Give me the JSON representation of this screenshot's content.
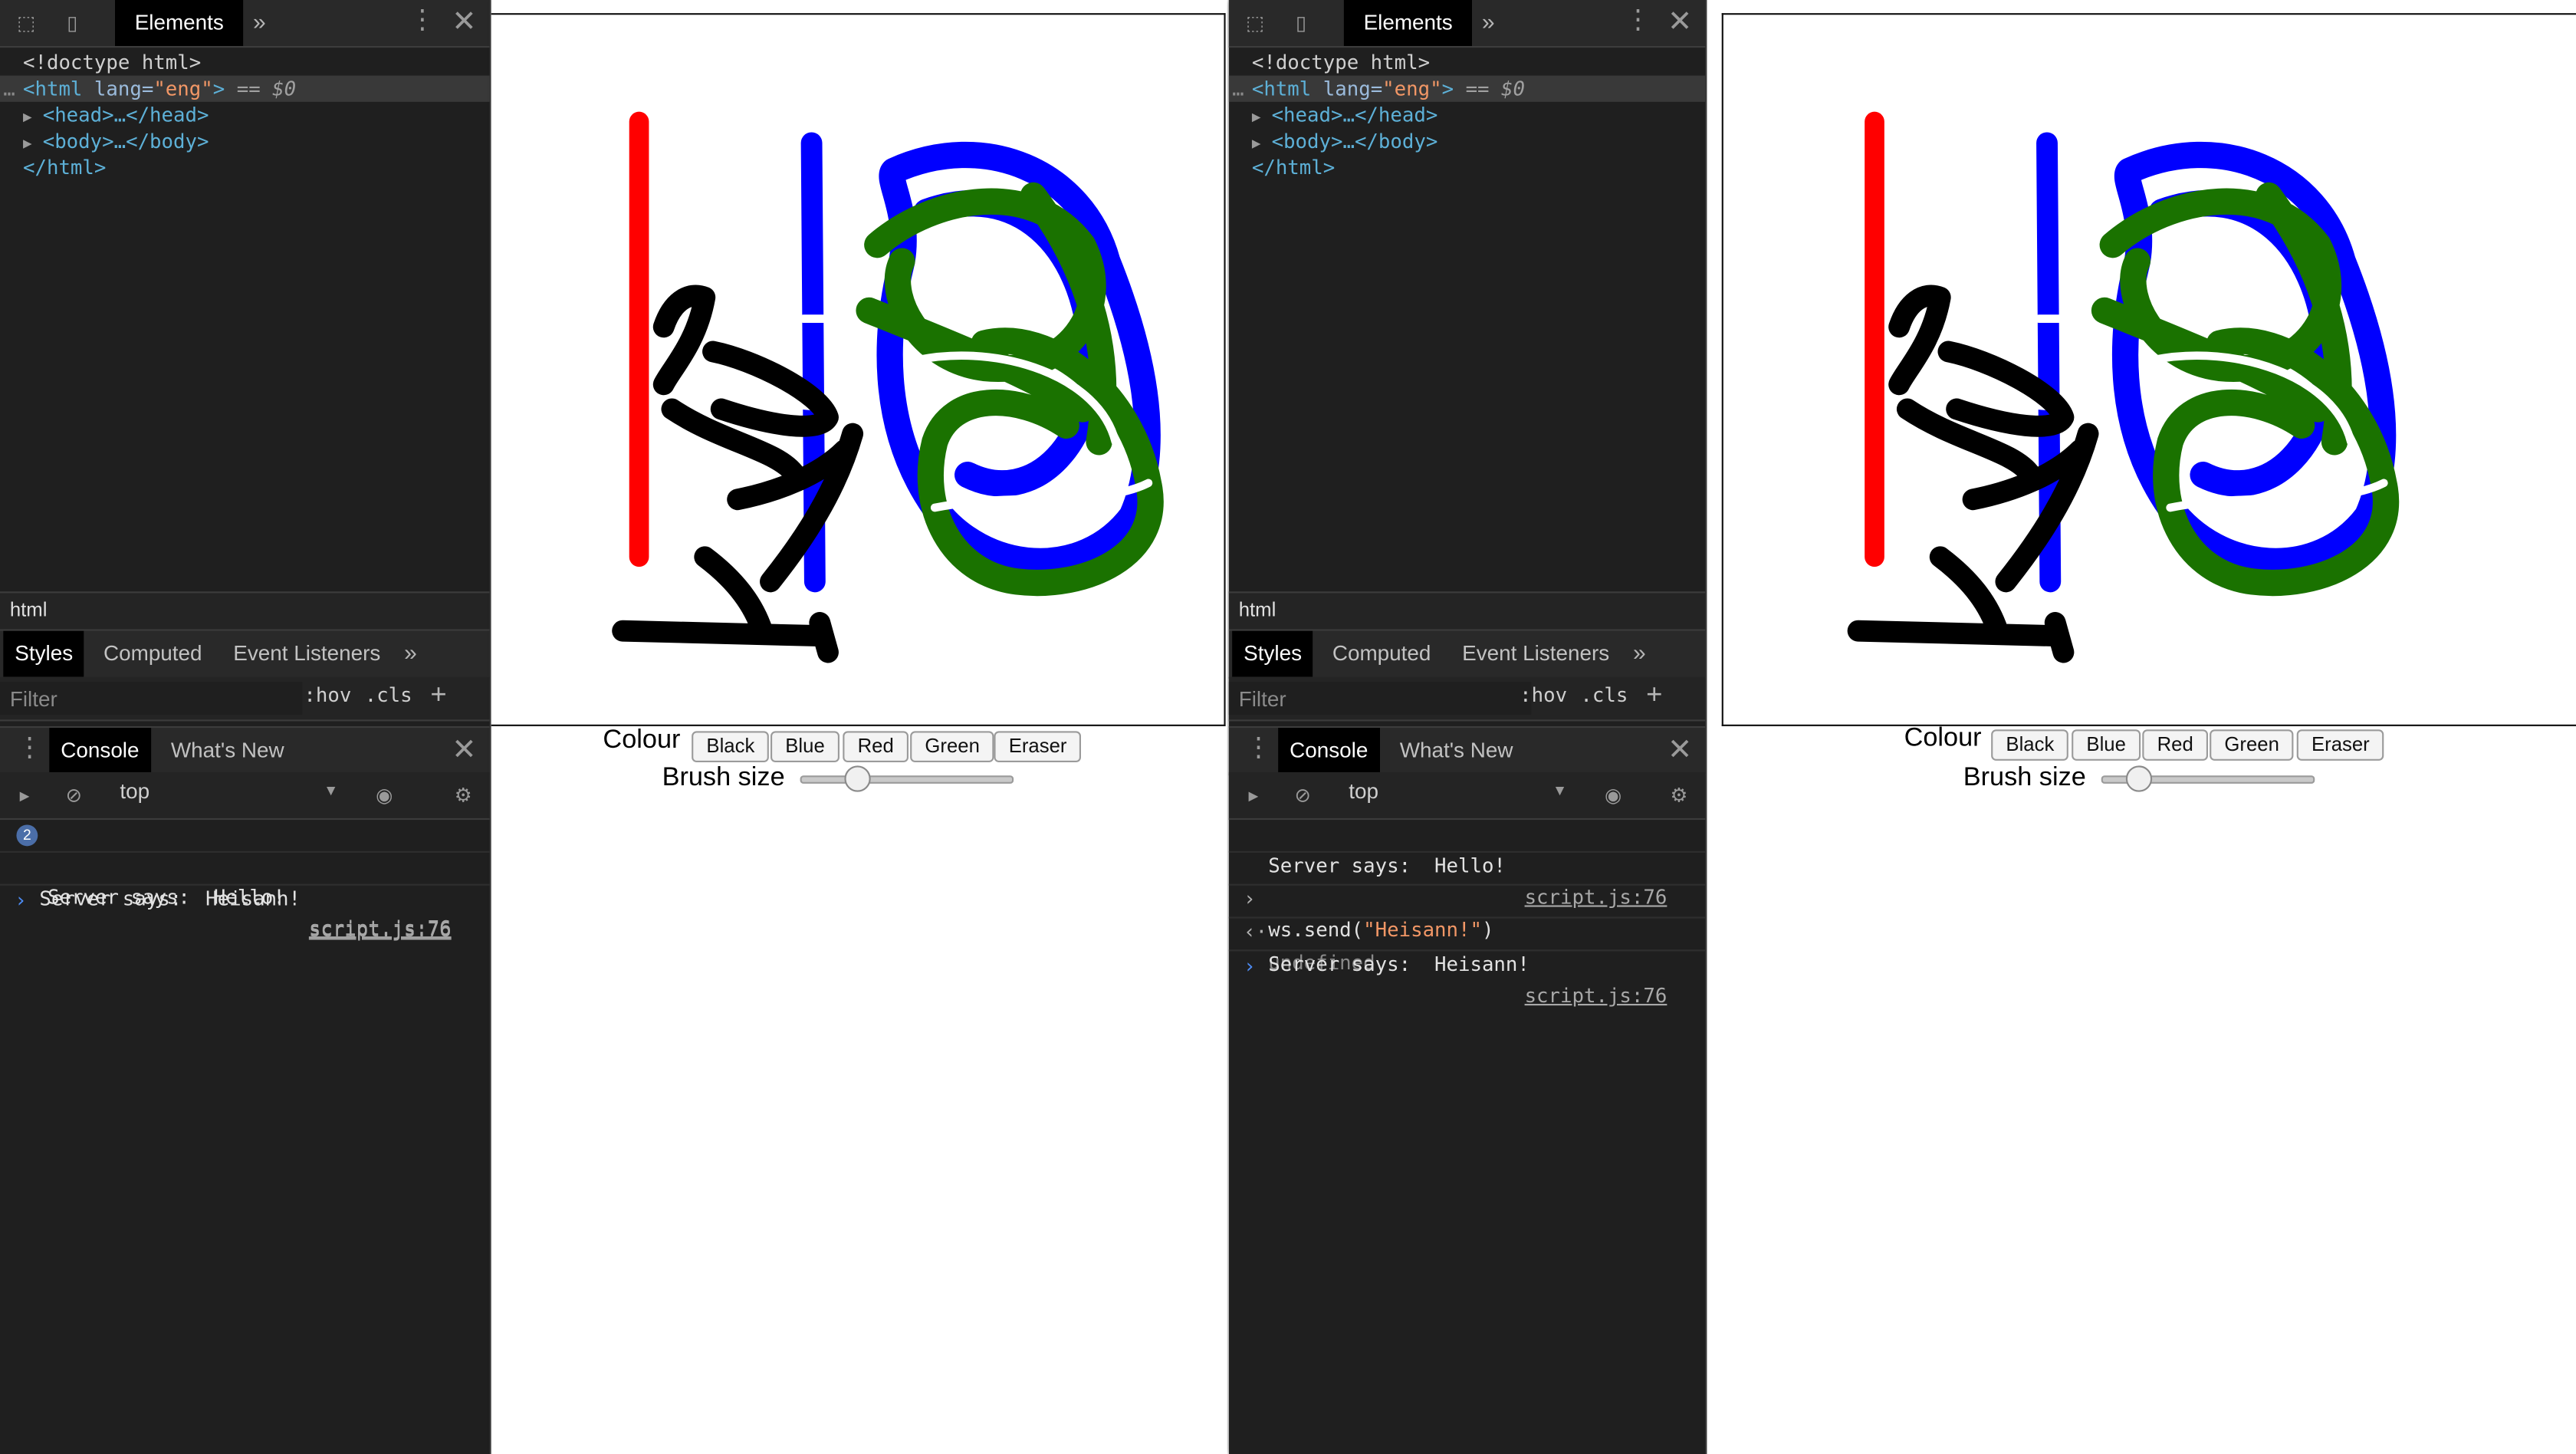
{
  "windows": [
    {
      "devtools": {
        "tabs": {
          "elements": "Elements"
        },
        "dom_tree": [
          {
            "text": "<!doctype html>"
          },
          {
            "tag_open": "<html ",
            "attr_name": "lang=",
            "attr_value": "\"eng\"",
            "tag_close": ">",
            "suffix": " == ",
            "dollar": "$0"
          },
          {
            "text": "<head>…</head>"
          },
          {
            "text": "<body>…</body>"
          },
          {
            "text": "</html>"
          }
        ],
        "breadcrumb": "html",
        "style_tabs": [
          "Styles",
          "Computed",
          "Event Listeners"
        ],
        "filter_placeholder": "Filter",
        "hov": ":hov",
        "cls": ".cls",
        "drawer_tabs": [
          "Console",
          "What's New"
        ],
        "context": "top",
        "console_lines": [
          {
            "badge": "2",
            "text": "Server says:  Hello!",
            "source": "script.js:76"
          },
          {
            "text": "Server says:  Heisann!",
            "source": "script.js:76"
          }
        ]
      },
      "page": {
        "colour_label": "Colour",
        "buttons": [
          "Black",
          "Blue",
          "Red",
          "Green",
          "Eraser"
        ],
        "brush_label": "Brush size",
        "brush_level": 0.26
      }
    },
    {
      "devtools": {
        "tabs": {
          "elements": "Elements"
        },
        "dom_tree": [
          {
            "text": "<!doctype html>"
          },
          {
            "tag_open": "<html ",
            "attr_name": "lang=",
            "attr_value": "\"eng\"",
            "tag_close": ">",
            "suffix": " == ",
            "dollar": "$0"
          },
          {
            "text": "<head>…</head>"
          },
          {
            "text": "<body>…</body>"
          },
          {
            "text": "</html>"
          }
        ],
        "breadcrumb": "html",
        "style_tabs": [
          "Styles",
          "Computed",
          "Event Listeners"
        ],
        "filter_placeholder": "Filter",
        "hov": ":hov",
        "cls": ".cls",
        "drawer_tabs": [
          "Console",
          "What's New"
        ],
        "context": "top",
        "console_lines": [
          {
            "text": "Server says:  Hello!",
            "source": "script.js:76"
          },
          {
            "input_fn": "ws.send",
            "input_arg": "\"Heisann!\""
          },
          {
            "result": "undefined"
          },
          {
            "text": "Server says:  Heisann!",
            "source": "script.js:76"
          }
        ]
      },
      "page": {
        "colour_label": "Colour",
        "buttons": [
          "Black",
          "Blue",
          "Red",
          "Green",
          "Eraser"
        ],
        "brush_label": "Brush size",
        "brush_level": 0.17
      }
    }
  ],
  "colors": {
    "stroke_red": "#ff0000",
    "stroke_blue": "#0000ff",
    "stroke_green": "#1a7200",
    "stroke_black": "#000000",
    "devtools_bg": "#1f1f1f"
  }
}
